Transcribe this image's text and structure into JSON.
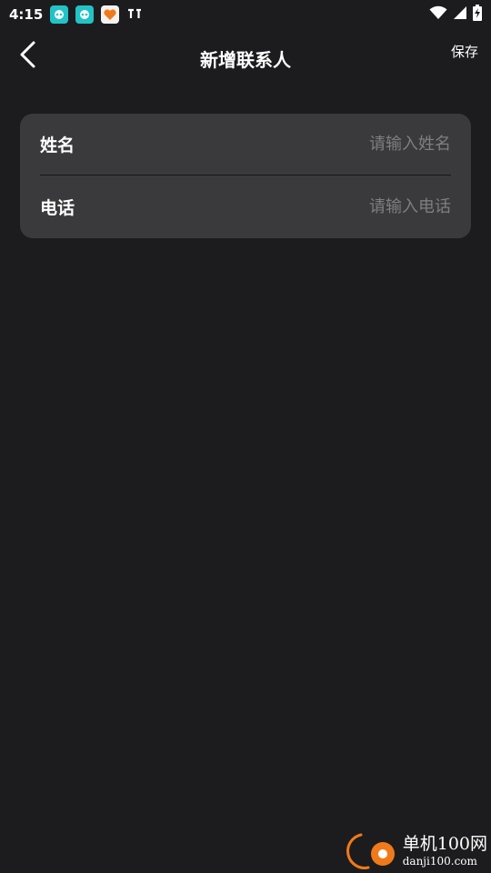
{
  "status_bar": {
    "time": "4:15",
    "icons": [
      "app-notif-icon",
      "app-notif-icon",
      "heart-app-icon",
      "signal-extra-icon"
    ],
    "right_icons": [
      "wifi-icon",
      "cell-signal-icon",
      "battery-charging-icon"
    ]
  },
  "header": {
    "title": "新增联系人",
    "save_label": "保存",
    "back_icon": "chevron-left-icon"
  },
  "form": {
    "name_label": "姓名",
    "name_placeholder": "请输入姓名",
    "name_value": "",
    "phone_label": "电话",
    "phone_placeholder": "请输入电话",
    "phone_value": ""
  },
  "watermark": {
    "title": "单机100网",
    "url": "danji100.com"
  },
  "colors": {
    "background": "#1c1c1e",
    "card": "#3a3a3c",
    "placeholder": "#7e7e82",
    "watermark_accent": "#f07a1a"
  }
}
